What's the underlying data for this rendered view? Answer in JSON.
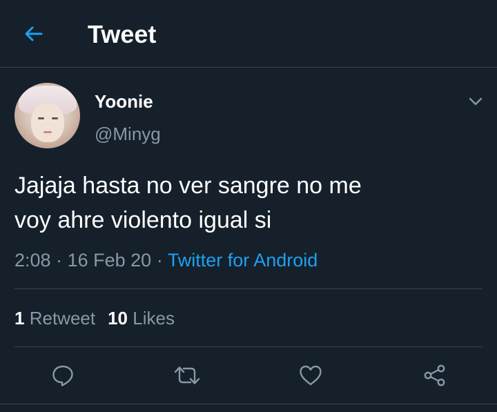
{
  "header": {
    "title": "Tweet",
    "back_icon": "arrow-left-icon"
  },
  "tweet": {
    "display_name": "Yoonie",
    "handle": "@Minyg",
    "text_line1": "Jajaja hasta no ver sangre no me",
    "text_line2": "voy ahre violento igual si",
    "time": "2:08",
    "date": "16 Feb 20",
    "source": "Twitter for Android",
    "separator": "·"
  },
  "stats": {
    "retweets_count": "1",
    "retweets_label": "Retweet",
    "likes_count": "10",
    "likes_label": "Likes"
  },
  "actions": {
    "reply_icon": "reply-icon",
    "retweet_icon": "retweet-icon",
    "like_icon": "heart-icon",
    "share_icon": "share-icon"
  },
  "colors": {
    "background": "#15202b",
    "accent": "#1da1f2",
    "secondary_text": "#8899a6",
    "divider": "#38444d"
  }
}
